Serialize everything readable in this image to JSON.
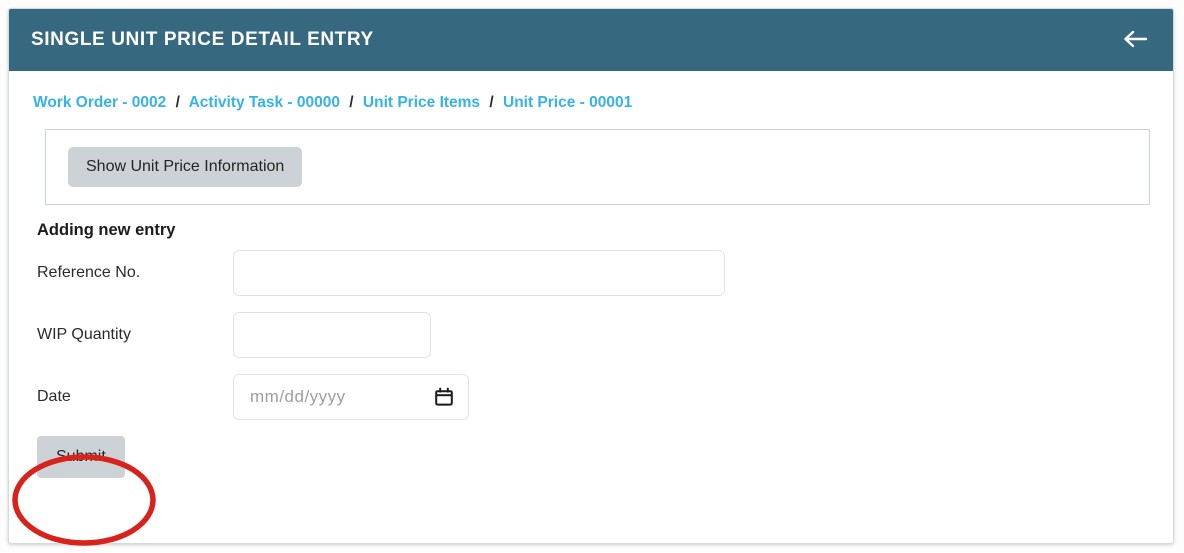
{
  "header": {
    "title": "SINGLE UNIT PRICE DETAIL ENTRY",
    "back_icon": "arrow-left-icon",
    "background_color": "#36697f",
    "title_color": "#ffffff"
  },
  "breadcrumb": {
    "separator": "/",
    "link_color": "#35b3e8",
    "items": [
      {
        "label": "Work Order - 0002"
      },
      {
        "label": "Activity Task - 00000"
      },
      {
        "label": "Unit Price Items"
      },
      {
        "label": "Unit Price - 00001"
      }
    ]
  },
  "info_panel": {
    "toggle_button_label": "Show Unit Price Information"
  },
  "form": {
    "section_title": "Adding new entry",
    "fields": [
      {
        "label": "Reference No.",
        "value": "",
        "placeholder": ""
      },
      {
        "label": "WIP Quantity",
        "value": "",
        "placeholder": ""
      },
      {
        "label": "Date",
        "value": "",
        "placeholder": "mm/dd/yyyy",
        "icon": "calendar-icon"
      }
    ],
    "submit_label": "Submit"
  },
  "annotation": {
    "shape": "ellipse",
    "color": "#d8231c",
    "target": "Submit"
  }
}
